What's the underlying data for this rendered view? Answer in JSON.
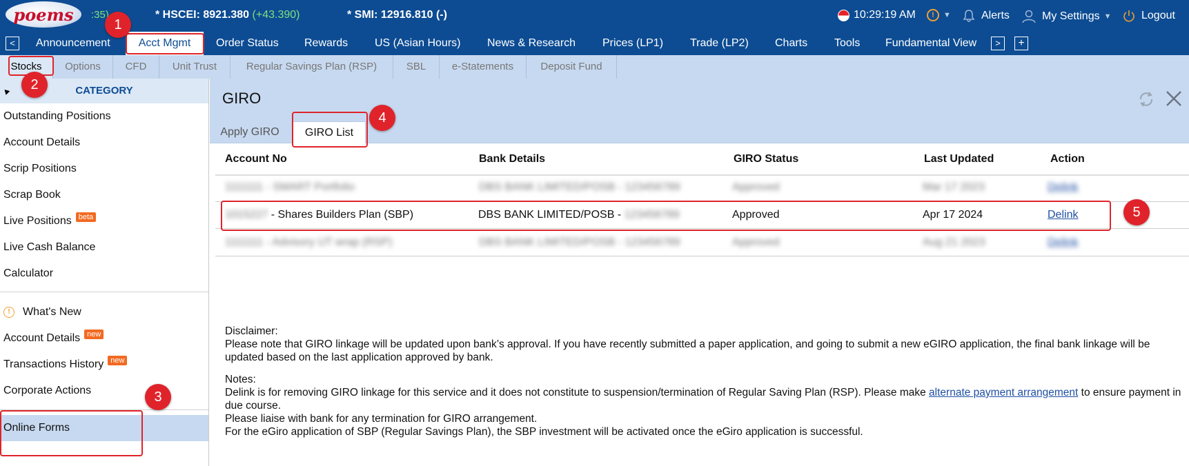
{
  "topbar": {
    "logo_text": "poems",
    "ticker_fragment": ":35)",
    "hscei_label": "* HSCEI: 8921.380",
    "hscei_change": "(+43.390)",
    "smi_label": "* SMI: 12916.810 (-)",
    "time": "10:29:19 AM",
    "alerts_label": "Alerts",
    "settings_label": "My Settings",
    "logout_label": "Logout"
  },
  "nav": {
    "items": [
      "Announcement",
      "Acct Mgmt",
      "Order Status",
      "Rewards",
      "US (Asian Hours)",
      "News & Research",
      "Prices (LP1)",
      "Trade (LP2)",
      "Charts",
      "Tools",
      "Fundamental View"
    ],
    "active": "Acct Mgmt"
  },
  "subnav": {
    "items": [
      "Stocks",
      "Options",
      "CFD",
      "Unit Trust",
      "Regular Savings Plan (RSP)",
      "SBL",
      "e-Statements",
      "Deposit Fund"
    ],
    "active": "Stocks"
  },
  "sidebar": {
    "category_label": "CATEGORY",
    "group1": [
      "Outstanding Positions",
      "Account Details",
      "Scrip Positions",
      "Scrap Book",
      "Live Positions",
      "Live Cash Balance",
      "Calculator"
    ],
    "beta_badge": "beta",
    "group2": [
      "What's New",
      "Account Details",
      "Transactions History",
      "Corporate Actions"
    ],
    "new_badge": "new",
    "selected_item": "Online Forms"
  },
  "panel": {
    "title": "GIRO",
    "tabs": [
      "Apply GIRO",
      "GIRO List"
    ],
    "active_tab": "GIRO List"
  },
  "table": {
    "headers": [
      "Account No",
      "Bank Details",
      "GIRO Status",
      "Last Updated",
      "Action"
    ],
    "rows": [
      {
        "account_masked": "1111111",
        "account_name": "- SMART Portfolio",
        "bank": "DBS BANK LIMITED/POSB -",
        "bank_acct_masked": "123456789",
        "status": "Approved",
        "updated": "Mar 17 2023",
        "action": "Delink",
        "blurred": true
      },
      {
        "account_masked": "1015227",
        "account_name": "- Shares Builders Plan (SBP)",
        "bank": "DBS BANK LIMITED/POSB -",
        "bank_acct_masked": "123456789",
        "status": "Approved",
        "updated": "Apr 17 2024",
        "action": "Delink",
        "blurred": false
      },
      {
        "account_masked": "1111111",
        "account_name": "- Advisory UT wrap (RSP)",
        "bank": "DBS BANK LIMITED/POSB -",
        "bank_acct_masked": "123456789",
        "status": "Approved",
        "updated": "Aug 21 2023",
        "action": "Delink",
        "blurred": true
      }
    ]
  },
  "disclaimer": {
    "heading": "Disclaimer:",
    "text": "Please note that GIRO linkage will be updated upon bank’s approval. If you have recently submitted a paper application, and going to submit a new eGIRO application, the final bank linkage will be updated based on the last application approved by bank."
  },
  "notes": {
    "heading": "Notes:",
    "line1_pre": "Delink is for removing GIRO linkage for this service and it does not constitute to suspension/termination of Regular Saving Plan (RSP). Please make ",
    "line1_link": "alternate payment arrangement",
    "line1_post": " to ensure payment in due course.",
    "line2": "Please liaise with bank for any termination for GIRO arrangement.",
    "line3": "For the eGiro application of SBP (Regular Savings Plan), the SBP investment will be activated once the eGiro application is successful."
  },
  "annotations": [
    "1",
    "2",
    "3",
    "4",
    "5"
  ],
  "colors": {
    "nav_bg": "#0d4c93",
    "panel_bg": "#c7d9f0",
    "annotation": "#e0232a",
    "positive": "#7ee07e"
  }
}
